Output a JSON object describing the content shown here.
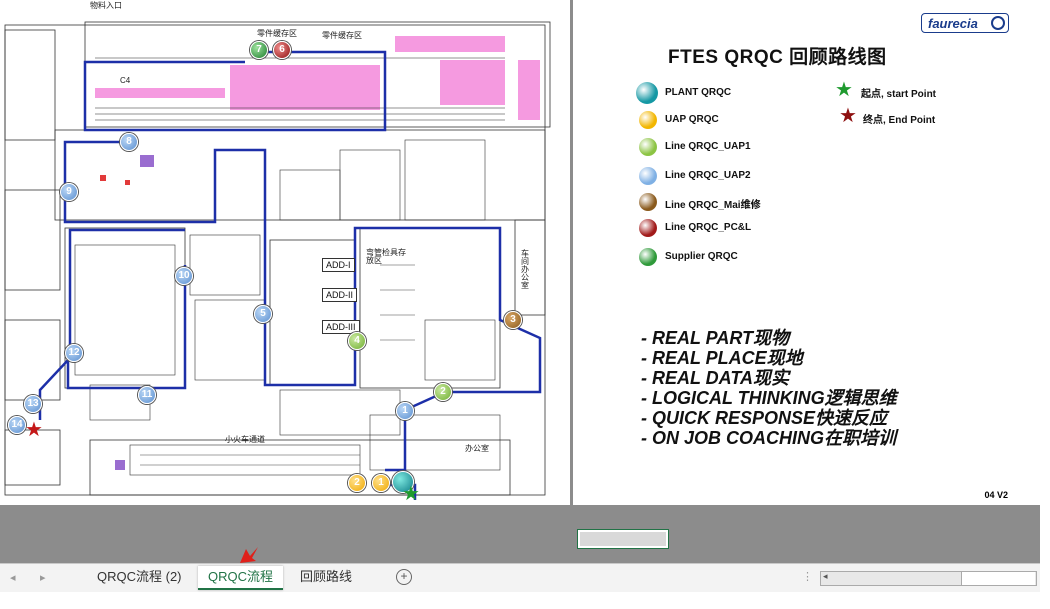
{
  "map": {
    "top_label": "物料入口",
    "labels": {
      "c4": "C4",
      "parts_area_1": "零件缓存区",
      "parts_area_2": "零件缓存区",
      "tool_area": "弯管检具存放区",
      "workshop_office": "车间办公室",
      "office": "办公室",
      "track": "小火车通道",
      "add_1": "ADD-I",
      "add_2": "ADD-II",
      "add_3": "ADD-III"
    },
    "waypoints": [
      "1",
      "1",
      "2",
      "2",
      "3",
      "4",
      "5",
      "6",
      "7",
      "8",
      "9",
      "10",
      "11",
      "12",
      "13",
      "14"
    ]
  },
  "slide": {
    "brand": "faurecia",
    "title": "FTES  QRQC 回顾路线图",
    "legend": [
      {
        "label": "PLANT QRQC",
        "color": "#1598a4"
      },
      {
        "label": "UAP QRQC",
        "color": "#f2b600"
      },
      {
        "label": "Line QRQC_UAP1",
        "color": "#8cc443"
      },
      {
        "label": "Line QRQC_UAP2",
        "color": "#7fb0e4"
      },
      {
        "label": "Line QRQC_Mai维修",
        "color": "#8a5a1c"
      },
      {
        "label": "Line QRQC_PC&L",
        "color": "#a11a1a"
      },
      {
        "label": "Supplier QRQC",
        "color": "#2f9a3a"
      }
    ],
    "start_label": "起点, start Point",
    "end_label": "终点, End Point",
    "start_color": "#1f9a2f",
    "end_color": "#8e1010",
    "principles": [
      "- REAL PART现物",
      "- REAL PLACE现地",
      "- REAL DATA现实",
      "- LOGICAL THINKING逻辑思维",
      "- QUICK RESPONSE快速反应",
      "- ON JOB COACHING在职培训"
    ],
    "version": "04 V2"
  },
  "tabs": {
    "sheets": [
      "QRQC流程 (2)",
      "QRQC流程",
      "回顾路线"
    ],
    "active_index": 1
  },
  "colors": {
    "route": "#1d2fa8",
    "accent": "#217346",
    "pink": "#f59ae0"
  }
}
